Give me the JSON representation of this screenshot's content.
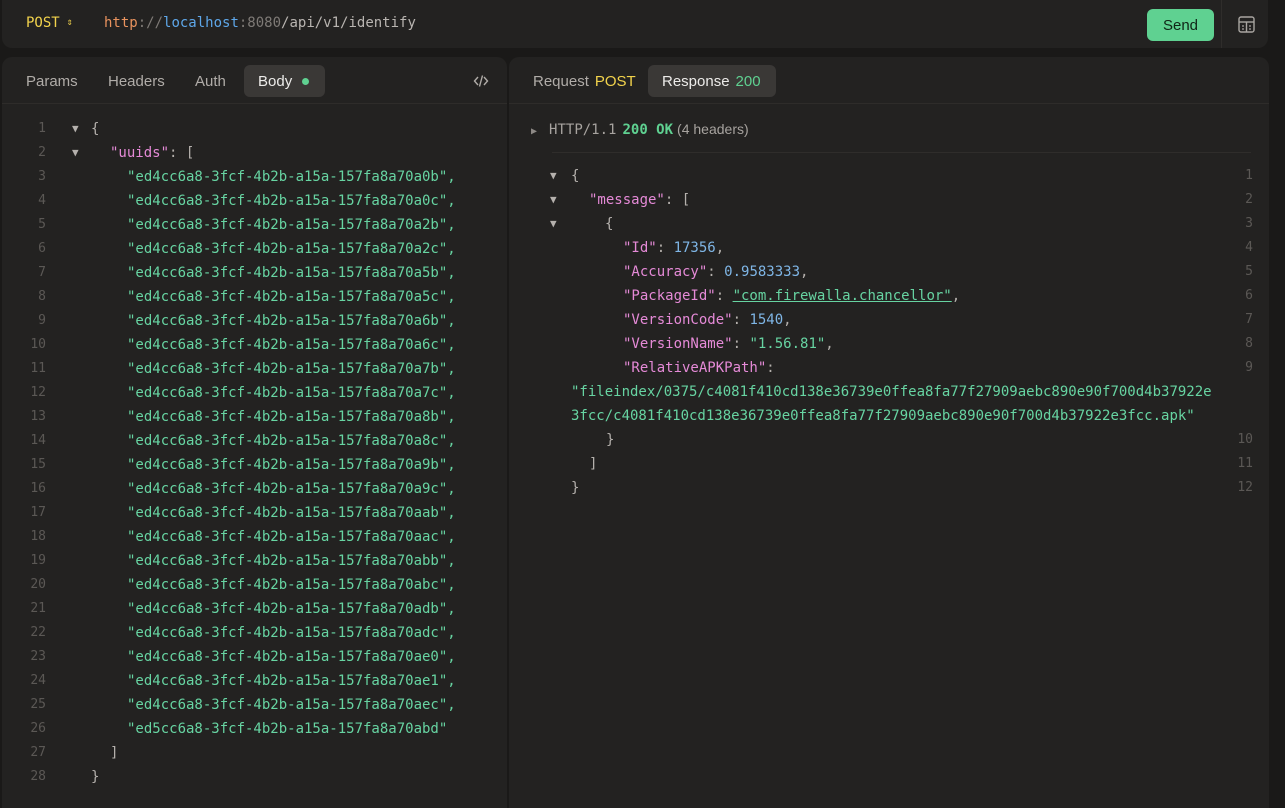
{
  "request": {
    "method": "POST",
    "method_arrows": "⇕",
    "url": {
      "scheme": "http",
      "sep": "://",
      "host": "localhost",
      "port": ":8080",
      "path": "/api/v1/identify"
    },
    "send_label": "Send"
  },
  "left_tabs": [
    {
      "label": "Params"
    },
    {
      "label": "Headers"
    },
    {
      "label": "Auth"
    },
    {
      "label": "Body"
    }
  ],
  "right_tabs": {
    "request_label": "Request",
    "request_tag": "POST",
    "response_label": "Response",
    "response_tag": "200"
  },
  "body": {
    "line_numbers": [
      "1",
      "2",
      "3",
      "4",
      "5",
      "6",
      "7",
      "8",
      "9",
      "10",
      "11",
      "12",
      "13",
      "14",
      "15",
      "16",
      "17",
      "18",
      "19",
      "20",
      "21",
      "22",
      "23",
      "24",
      "25",
      "26",
      "27",
      "28"
    ],
    "open_brace": "{",
    "uuids_key": "\"uuids\"",
    "colon_bracket": ": [",
    "uuids": [
      "\"ed4cc6a8-3fcf-4b2b-a15a-157fa8a70a0b\",",
      "\"ed4cc6a8-3fcf-4b2b-a15a-157fa8a70a0c\",",
      "\"ed4cc6a8-3fcf-4b2b-a15a-157fa8a70a2b\",",
      "\"ed4cc6a8-3fcf-4b2b-a15a-157fa8a70a2c\",",
      "\"ed4cc6a8-3fcf-4b2b-a15a-157fa8a70a5b\",",
      "\"ed4cc6a8-3fcf-4b2b-a15a-157fa8a70a5c\",",
      "\"ed4cc6a8-3fcf-4b2b-a15a-157fa8a70a6b\",",
      "\"ed4cc6a8-3fcf-4b2b-a15a-157fa8a70a6c\",",
      "\"ed4cc6a8-3fcf-4b2b-a15a-157fa8a70a7b\",",
      "\"ed4cc6a8-3fcf-4b2b-a15a-157fa8a70a7c\",",
      "\"ed4cc6a8-3fcf-4b2b-a15a-157fa8a70a8b\",",
      "\"ed4cc6a8-3fcf-4b2b-a15a-157fa8a70a8c\",",
      "\"ed4cc6a8-3fcf-4b2b-a15a-157fa8a70a9b\",",
      "\"ed4cc6a8-3fcf-4b2b-a15a-157fa8a70a9c\",",
      "\"ed4cc6a8-3fcf-4b2b-a15a-157fa8a70aab\",",
      "\"ed4cc6a8-3fcf-4b2b-a15a-157fa8a70aac\",",
      "\"ed4cc6a8-3fcf-4b2b-a15a-157fa8a70abb\",",
      "\"ed4cc6a8-3fcf-4b2b-a15a-157fa8a70abc\",",
      "\"ed4cc6a8-3fcf-4b2b-a15a-157fa8a70adb\",",
      "\"ed4cc6a8-3fcf-4b2b-a15a-157fa8a70adc\",",
      "\"ed4cc6a8-3fcf-4b2b-a15a-157fa8a70ae0\",",
      "\"ed4cc6a8-3fcf-4b2b-a15a-157fa8a70ae1\",",
      "\"ed4cc6a8-3fcf-4b2b-a15a-157fa8a70aec\",",
      "\"ed5cc6a8-3fcf-4b2b-a15a-157fa8a70abd\""
    ],
    "close_bracket": "]",
    "close_brace": "}"
  },
  "response": {
    "proto": "HTTP/1.1",
    "status": "200 OK",
    "headers_count": "(4 headers)",
    "line_numbers": [
      "1",
      "2",
      "3",
      "4",
      "5",
      "6",
      "7",
      "8",
      "9",
      "10",
      "11",
      "12"
    ],
    "open_brace": "{",
    "message_key": "\"message\"",
    "colon_bracket": ": [",
    "inner_open": "{",
    "fields": [
      {
        "key": "\"Id\"",
        "value": "17356",
        "kind": "num"
      },
      {
        "key": "\"Accuracy\"",
        "value": "0.9583333",
        "kind": "num"
      },
      {
        "key": "\"PackageId\"",
        "value": "\"com.firewalla.chancellor\"",
        "kind": "link"
      },
      {
        "key": "\"VersionCode\"",
        "value": "1540",
        "kind": "num"
      },
      {
        "key": "\"VersionName\"",
        "value": "\"1.56.81\"",
        "kind": "str"
      }
    ],
    "apk_key": "\"RelativeAPKPath\"",
    "apk_value_line1": "\"fileindex/0375/c4081f410cd138e36739e0ffea8fa77f27909aebc890e90f700d4b37922e",
    "apk_value_line2": "3fcc/c4081f410cd138e36739e0ffea8fa77f27909aebc890e90f700d4b37922e3fcc.apk\"",
    "inner_close": "}",
    "close_bracket": "]",
    "close_brace": "}"
  },
  "colors": {
    "accent_green": "#5fd191",
    "method_yellow": "#f2d34c",
    "key_pink": "#e58ad7",
    "string_green": "#67d4a2",
    "number_blue": "#7fb6e6"
  }
}
